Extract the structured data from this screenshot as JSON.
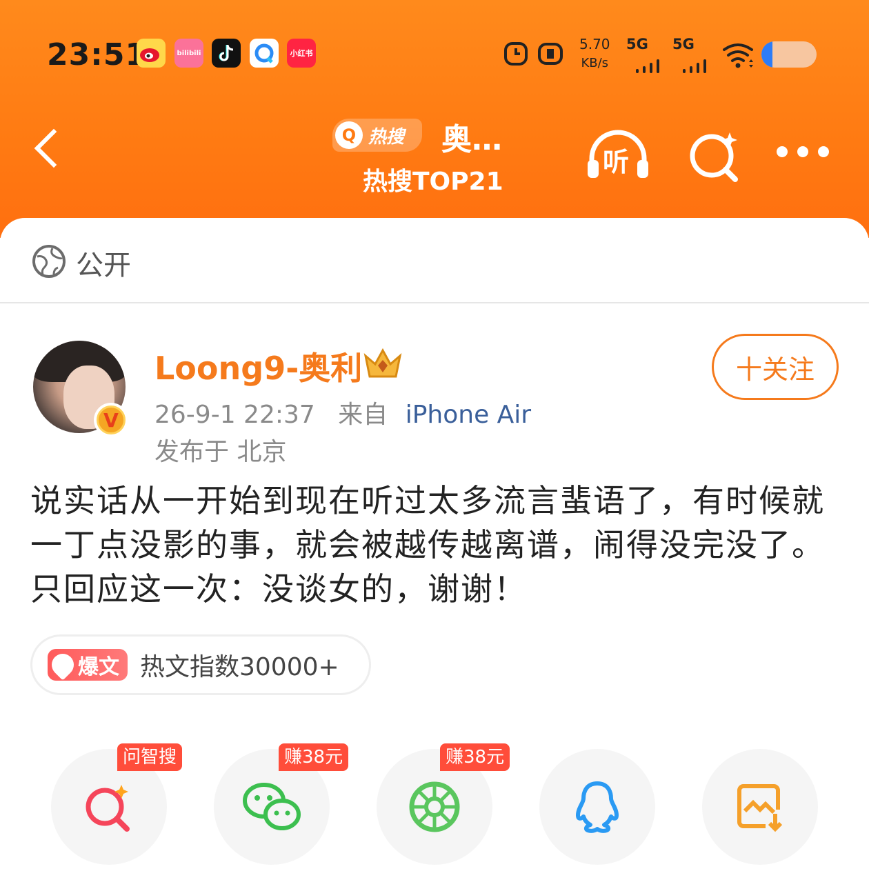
{
  "status_bar": {
    "time": "23:51",
    "apps": [
      "weibo-icon",
      "bilibili-icon",
      "tiktok-icon",
      "qq-browser-icon",
      "xiaohongshu-icon"
    ],
    "bilibili_label": "bilibili",
    "xiaohongshu_label": "小红书",
    "net_speed_value": "5.70",
    "net_speed_unit": "KB/s",
    "sim1": "5G",
    "sim2": "5G",
    "battery_level": 0.2
  },
  "nav": {
    "hot_badge": "热搜",
    "title": "奥…",
    "subtitle": "热搜TOP21",
    "listen_label": "听"
  },
  "visibility": {
    "label": "公开"
  },
  "post": {
    "author": "Loong9-奥利",
    "follow_label": "十关注",
    "date": "26-9-1 22:37",
    "from_label": "来自",
    "device": "iPhone Air",
    "location": "发布于 北京",
    "text": "说实话从一开始到现在听过太多流言蜚语了，有时候就一丁点没影的事，就会被越传越离谱，闹得没完没了。只回应这一次：没谈女的，谢谢！",
    "hot_tag": "爆文",
    "hot_index": "热文指数30000+"
  },
  "share": [
    {
      "name": "ai-search",
      "tag": "问智搜"
    },
    {
      "name": "wechat",
      "tag": "赚38元"
    },
    {
      "name": "moments",
      "tag": "赚38元"
    },
    {
      "name": "qq",
      "tag": ""
    },
    {
      "name": "save-image",
      "tag": ""
    }
  ],
  "colors": {
    "brand_orange": "#ff7a12",
    "accent_orange": "#f57a1c",
    "tag_red": "#ff4d3a",
    "device_blue": "#3a5f9a"
  }
}
